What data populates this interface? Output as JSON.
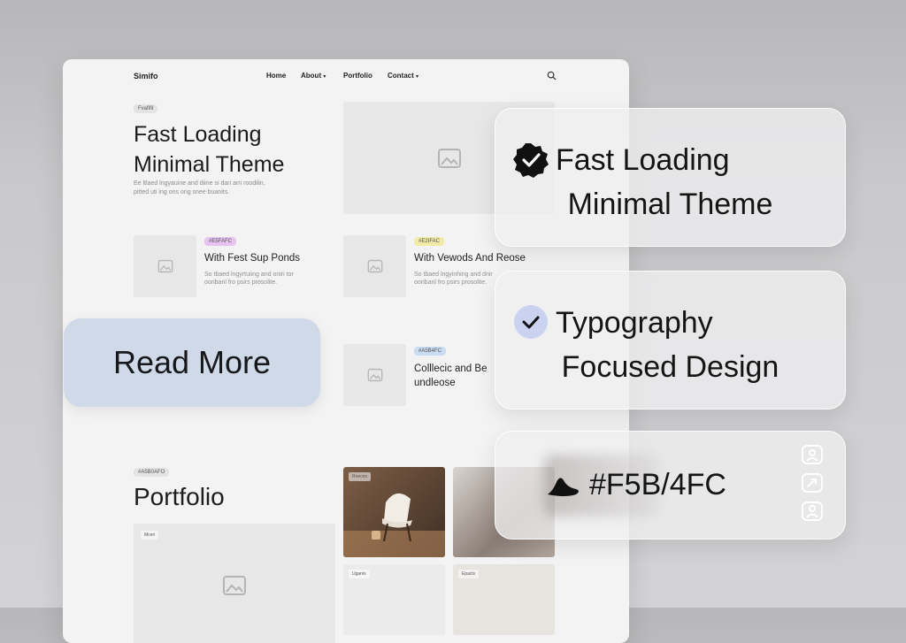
{
  "site": {
    "brand": "Simifo",
    "nav": {
      "home": "Home",
      "about": "About",
      "portfolio": "Portfolio",
      "contact": "Contact"
    },
    "hero": {
      "tag": "Fvafifil",
      "title_line1": "Fast Loading",
      "title_line2": "Minimal Theme",
      "sub_line1": "Ee ltlaed lngyauine and diine si dari arri roodilin,",
      "sub_line2": "pitted uti ing ons ong snee buanits."
    },
    "posts": [
      {
        "tag": "#E5FAFC",
        "tag_color": "#e7c4f0",
        "title": "With Fest Sup Ponds",
        "sub_line1": "So tbaed lngyrtuiing and oniri tor",
        "sub_line2": "ooribanl fro psirs prosolite."
      },
      {
        "tag": "#E2IFAC",
        "tag_color": "#f2eba8",
        "title": "With Vewods And Reose",
        "sub_line1": "So tbaed lngyinhing and dnir",
        "sub_line2": "ooribanl fro psirs prosolite."
      },
      {
        "tag": "#A5B4FC",
        "tag_color": "#c9dcf1",
        "title_line1": "Colllecic and Be",
        "title_line2": "undleose"
      }
    ],
    "portfolio": {
      "tag": "#A5B0AFO",
      "title": "Portfolio",
      "labels": [
        "Mcen",
        "Rneces",
        "Uganis",
        "Epacls"
      ]
    }
  },
  "read_more": "Read More",
  "cards": [
    {
      "icon": "verified-badge-icon",
      "line1": "Fast Loading",
      "line2": "Minimal Theme"
    },
    {
      "icon": "check-circle-icon",
      "line1": "Typography",
      "line2": "Focused Design"
    },
    {
      "icon": "color-blob-icon",
      "line1": "#F5B/4FC"
    }
  ],
  "colors": {
    "accent_blue": "#d0d9e8",
    "check_circle": "#c9d3f0"
  }
}
